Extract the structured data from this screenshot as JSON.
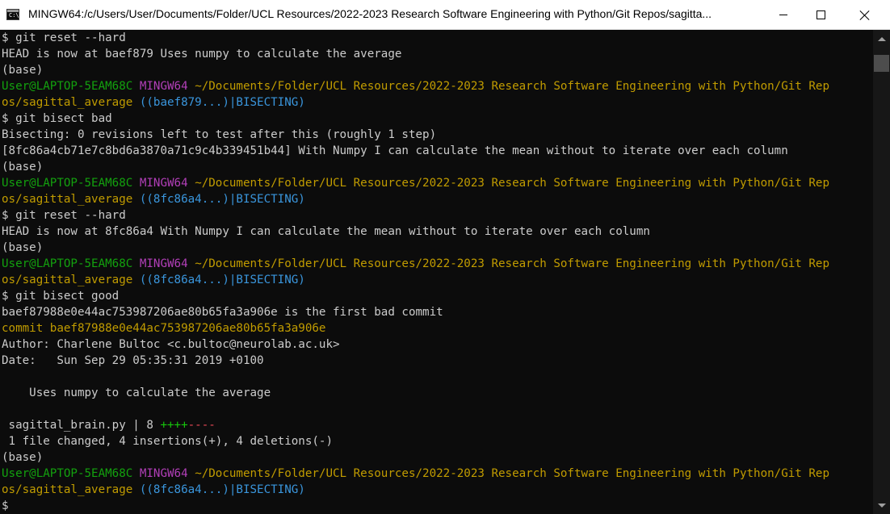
{
  "window": {
    "title": "MINGW64:/c/Users/User/Documents/Folder/UCL Resources/2022-2023 Research Software Engineering with Python/Git Repos/sagitta...",
    "icon_text": "C:\\",
    "icon": "terminal-icon",
    "controls": [
      "minimize-icon",
      "maximize-icon",
      "close-icon"
    ]
  },
  "colors": {
    "background": "#0c0c0c",
    "text": "#cccccc",
    "green": "#13a10e",
    "magenta": "#b23fb8",
    "yellow": "#c19c00",
    "cyan": "#3a96dd",
    "insert": "#16c60c",
    "delete": "#e74856"
  },
  "terminal": {
    "lines": [
      [
        {
          "t": "$ git reset --hard"
        }
      ],
      [
        {
          "t": "HEAD is now at baef879 Uses numpy to calculate the average"
        }
      ],
      [
        {
          "t": "(base)"
        }
      ],
      [
        {
          "t": "User@LAPTOP-5EAM68C",
          "c": "green"
        },
        {
          "t": " "
        },
        {
          "t": "MINGW64",
          "c": "magenta"
        },
        {
          "t": " "
        },
        {
          "t": "~/Documents/Folder/UCL Resources/2022-2023 Research Software Engineering with Python/Git Rep",
          "c": "yellow"
        }
      ],
      [
        {
          "t": "os/sagittal_average",
          "c": "yellow"
        },
        {
          "t": " "
        },
        {
          "t": "((baef879...)|BISECTING)",
          "c": "cyan"
        }
      ],
      [
        {
          "t": "$ git bisect bad"
        }
      ],
      [
        {
          "t": "Bisecting: 0 revisions left to test after this (roughly 1 step)"
        }
      ],
      [
        {
          "t": "[8fc86a4cb71e7c8bd6a3870a71c9c4b339451b44] With Numpy I can calculate the mean without to iterate over each column"
        }
      ],
      [
        {
          "t": "(base)"
        }
      ],
      [
        {
          "t": "User@LAPTOP-5EAM68C",
          "c": "green"
        },
        {
          "t": " "
        },
        {
          "t": "MINGW64",
          "c": "magenta"
        },
        {
          "t": " "
        },
        {
          "t": "~/Documents/Folder/UCL Resources/2022-2023 Research Software Engineering with Python/Git Rep",
          "c": "yellow"
        }
      ],
      [
        {
          "t": "os/sagittal_average",
          "c": "yellow"
        },
        {
          "t": " "
        },
        {
          "t": "((8fc86a4...)|BISECTING)",
          "c": "cyan"
        }
      ],
      [
        {
          "t": "$ git reset --hard"
        }
      ],
      [
        {
          "t": "HEAD is now at 8fc86a4 With Numpy I can calculate the mean without to iterate over each column"
        }
      ],
      [
        {
          "t": "(base)"
        }
      ],
      [
        {
          "t": "User@LAPTOP-5EAM68C",
          "c": "green"
        },
        {
          "t": " "
        },
        {
          "t": "MINGW64",
          "c": "magenta"
        },
        {
          "t": " "
        },
        {
          "t": "~/Documents/Folder/UCL Resources/2022-2023 Research Software Engineering with Python/Git Rep",
          "c": "yellow"
        }
      ],
      [
        {
          "t": "os/sagittal_average",
          "c": "yellow"
        },
        {
          "t": " "
        },
        {
          "t": "((8fc86a4...)|BISECTING)",
          "c": "cyan"
        }
      ],
      [
        {
          "t": "$ git bisect good"
        }
      ],
      [
        {
          "t": "baef87988e0e44ac753987206ae80b65fa3a906e is the first bad commit"
        }
      ],
      [
        {
          "t": "commit baef87988e0e44ac753987206ae80b65fa3a906e",
          "c": "yellow"
        }
      ],
      [
        {
          "t": "Author: Charlene Bultoc <c.bultoc@neurolab.ac.uk>"
        }
      ],
      [
        {
          "t": "Date:   Sun Sep 29 05:35:31 2019 +0100"
        }
      ],
      [
        {
          "t": ""
        }
      ],
      [
        {
          "t": "    Uses numpy to calculate the average"
        }
      ],
      [
        {
          "t": ""
        }
      ],
      [
        {
          "t": " sagittal_brain.py | 8 "
        },
        {
          "t": "++++",
          "c": "insert"
        },
        {
          "t": "----",
          "c": "delete"
        }
      ],
      [
        {
          "t": " 1 file changed, 4 insertions(+), 4 deletions(-)"
        }
      ],
      [
        {
          "t": "(base)"
        }
      ],
      [
        {
          "t": "User@LAPTOP-5EAM68C",
          "c": "green"
        },
        {
          "t": " "
        },
        {
          "t": "MINGW64",
          "c": "magenta"
        },
        {
          "t": " "
        },
        {
          "t": "~/Documents/Folder/UCL Resources/2022-2023 Research Software Engineering with Python/Git Rep",
          "c": "yellow"
        }
      ],
      [
        {
          "t": "os/sagittal_average",
          "c": "yellow"
        },
        {
          "t": " "
        },
        {
          "t": "((8fc86a4...)|BISECTING)",
          "c": "cyan"
        }
      ],
      [
        {
          "t": "$"
        }
      ]
    ]
  }
}
